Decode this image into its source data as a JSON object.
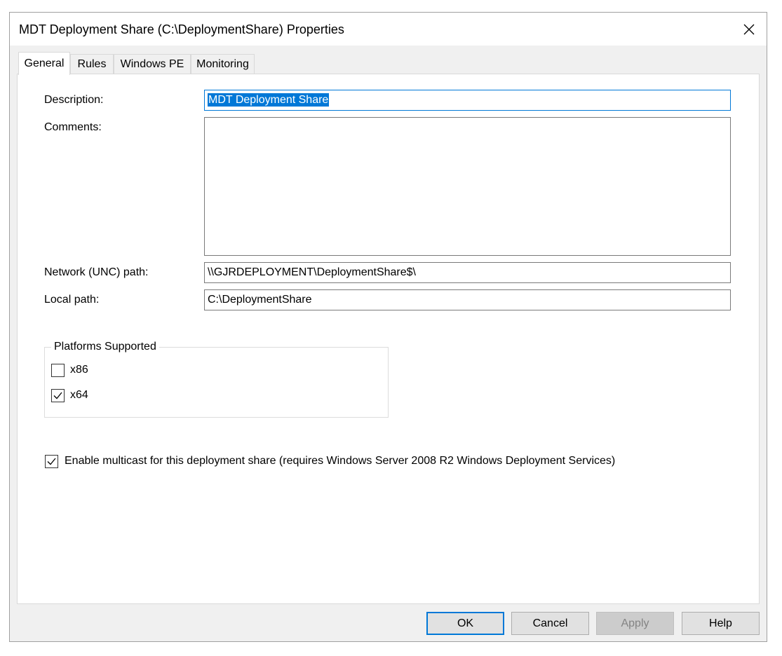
{
  "window": {
    "title": "MDT Deployment Share (C:\\DeploymentShare) Properties"
  },
  "tabs": [
    {
      "label": "General",
      "active": true
    },
    {
      "label": "Rules",
      "active": false
    },
    {
      "label": "Windows PE",
      "active": false
    },
    {
      "label": "Monitoring",
      "active": false
    }
  ],
  "general": {
    "description_label": "Description:",
    "description_value": "MDT Deployment Share",
    "comments_label": "Comments:",
    "comments_value": "",
    "unc_label": "Network (UNC) path:",
    "unc_value": "\\\\GJRDEPLOYMENT\\DeploymentShare$\\",
    "local_label": "Local path:",
    "local_value": "C:\\DeploymentShare"
  },
  "platforms": {
    "legend": "Platforms Supported",
    "x86": {
      "label": "x86",
      "checked": false
    },
    "x64": {
      "label": "x64",
      "checked": true
    }
  },
  "multicast": {
    "label": "Enable multicast for this deployment share (requires Windows Server 2008 R2 Windows Deployment Services)",
    "checked": true
  },
  "buttons": {
    "ok": "OK",
    "cancel": "Cancel",
    "apply": "Apply",
    "help": "Help"
  },
  "colors": {
    "accent": "#0078d7",
    "dialog_bg": "#f0f0f0",
    "panel_bg": "#ffffff"
  },
  "icons": {
    "close": "close-icon",
    "check": "checkmark-icon"
  }
}
